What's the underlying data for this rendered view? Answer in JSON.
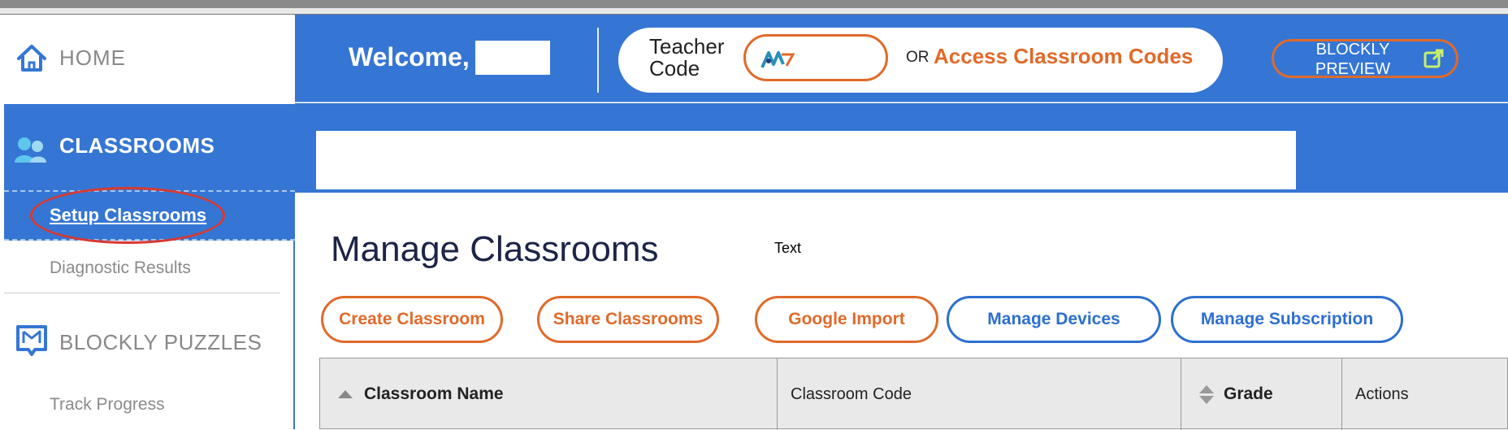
{
  "sidebar": {
    "home_label": "HOME",
    "classrooms_label": "CLASSROOMS",
    "setup_classrooms": "Setup Classrooms",
    "diagnostic_results": "Diagnostic Results",
    "blockly_puzzles": "BLOCKLY PUZZLES",
    "track_progress": "Track Progress"
  },
  "header": {
    "welcome": "Welcome,",
    "teacher_code_label_line1": "Teacher",
    "teacher_code_label_line2": "Code",
    "or": "OR",
    "access_codes": "Access Classroom Codes",
    "blockly_preview_line1": "BLOCKLY",
    "blockly_preview_line2": "PREVIEW"
  },
  "main": {
    "title": "Manage Classrooms",
    "text_label": "Text",
    "buttons": {
      "create": "Create Classroom",
      "share": "Share Classrooms",
      "google": "Google Import",
      "devices": "Manage Devices",
      "subscription": "Manage Subscription"
    },
    "table": {
      "columns": [
        "Classroom Name",
        "Classroom Code",
        "Grade",
        "Actions"
      ]
    }
  },
  "colors": {
    "primary_blue": "#3576d4",
    "accent_orange": "#e06a2a",
    "highlight_red": "#d9392f"
  }
}
